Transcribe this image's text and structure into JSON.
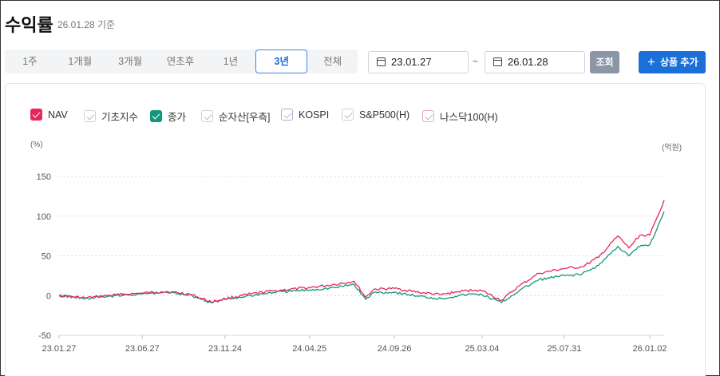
{
  "header": {
    "title": "수익률",
    "date": "26.01.28 기준"
  },
  "periods": [
    {
      "label": "1주",
      "active": false
    },
    {
      "label": "1개월",
      "active": false
    },
    {
      "label": "3개월",
      "active": false
    },
    {
      "label": "연초후",
      "active": false
    },
    {
      "label": "1년",
      "active": false
    },
    {
      "label": "3년",
      "active": true
    },
    {
      "label": "전체",
      "active": false
    }
  ],
  "date_range": {
    "start": "23.01.27",
    "separator": "~",
    "end": "26.01.28"
  },
  "buttons": {
    "search": "조회",
    "add": "상품 추가"
  },
  "legend": [
    {
      "label": "NAV",
      "checked": true,
      "color": "#e8265a"
    },
    {
      "label": "기초지수",
      "checked": false,
      "color": "#bbbbbb"
    },
    {
      "label": "종가",
      "checked": true,
      "color": "#14957f"
    },
    {
      "label": "순자산[우측]",
      "checked": false,
      "color": "#bbbbbb"
    },
    {
      "label": "KOSPI",
      "checked": false,
      "color": "#b9a6d8"
    },
    {
      "label": "S&P500(H)",
      "checked": false,
      "color": "#bbbbbb"
    },
    {
      "label": "나스닥100(H)",
      "checked": false,
      "color": "#e0a6c6"
    }
  ],
  "chart_data": {
    "type": "line",
    "y_unit_left": "(%)",
    "y_unit_right": "(억원)",
    "yticks": [
      "150",
      "100",
      "50",
      "0",
      "-50"
    ],
    "ylim": [
      -50,
      150
    ],
    "xlim": [
      "23.01.27",
      "26.01.28"
    ],
    "xtick_labels": [
      "23.01.27",
      "23.06.27",
      "23.11.24",
      "24.04.25",
      "24.09.26",
      "25.03.04",
      "25.07.31",
      "26.01.02"
    ],
    "grid": true,
    "series": [
      {
        "name": "NAV",
        "color": "#e8265a",
        "points": [
          [
            "23.01.27",
            0
          ],
          [
            "23.03.15",
            -3
          ],
          [
            "23.05.10",
            1
          ],
          [
            "23.06.27",
            3
          ],
          [
            "23.08.10",
            5
          ],
          [
            "23.09.20",
            2
          ],
          [
            "23.10.30",
            -8
          ],
          [
            "23.11.24",
            -4
          ],
          [
            "24.01.10",
            2
          ],
          [
            "24.02.20",
            6
          ],
          [
            "24.04.25",
            10
          ],
          [
            "24.06.10",
            14
          ],
          [
            "24.07.15",
            18
          ],
          [
            "24.08.05",
            -2
          ],
          [
            "24.08.20",
            8
          ],
          [
            "24.09.26",
            9
          ],
          [
            "24.11.10",
            4
          ],
          [
            "24.12.20",
            1
          ],
          [
            "25.01.20",
            5
          ],
          [
            "25.02.20",
            7
          ],
          [
            "25.03.04",
            6
          ],
          [
            "25.04.08",
            -6
          ],
          [
            "25.05.10",
            12
          ],
          [
            "25.06.15",
            28
          ],
          [
            "25.07.31",
            34
          ],
          [
            "25.09.01",
            36
          ],
          [
            "25.10.01",
            48
          ],
          [
            "25.11.05",
            75
          ],
          [
            "25.11.25",
            60
          ],
          [
            "25.12.15",
            76
          ],
          [
            "26.01.02",
            76
          ],
          [
            "26.01.15",
            98
          ],
          [
            "26.01.28",
            120
          ]
        ]
      },
      {
        "name": "종가",
        "color": "#14957f",
        "points": [
          [
            "23.01.27",
            0
          ],
          [
            "23.03.15",
            -4
          ],
          [
            "23.05.10",
            0
          ],
          [
            "23.06.27",
            2
          ],
          [
            "23.08.10",
            4
          ],
          [
            "23.09.20",
            1
          ],
          [
            "23.10.30",
            -9
          ],
          [
            "23.11.24",
            -5
          ],
          [
            "24.01.10",
            0
          ],
          [
            "24.02.20",
            4
          ],
          [
            "24.04.25",
            7
          ],
          [
            "24.06.10",
            10
          ],
          [
            "24.07.15",
            14
          ],
          [
            "24.08.05",
            -5
          ],
          [
            "24.08.20",
            4
          ],
          [
            "24.09.26",
            4
          ],
          [
            "24.11.10",
            -1
          ],
          [
            "24.12.20",
            -4
          ],
          [
            "25.01.20",
            0
          ],
          [
            "25.02.20",
            2
          ],
          [
            "25.03.04",
            1
          ],
          [
            "25.04.08",
            -9
          ],
          [
            "25.05.10",
            6
          ],
          [
            "25.06.15",
            20
          ],
          [
            "25.07.31",
            25
          ],
          [
            "25.09.01",
            27
          ],
          [
            "25.10.01",
            38
          ],
          [
            "25.11.05",
            62
          ],
          [
            "25.11.25",
            50
          ],
          [
            "25.12.15",
            62
          ],
          [
            "26.01.02",
            64
          ],
          [
            "26.01.15",
            84
          ],
          [
            "26.01.28",
            106
          ]
        ]
      }
    ]
  }
}
